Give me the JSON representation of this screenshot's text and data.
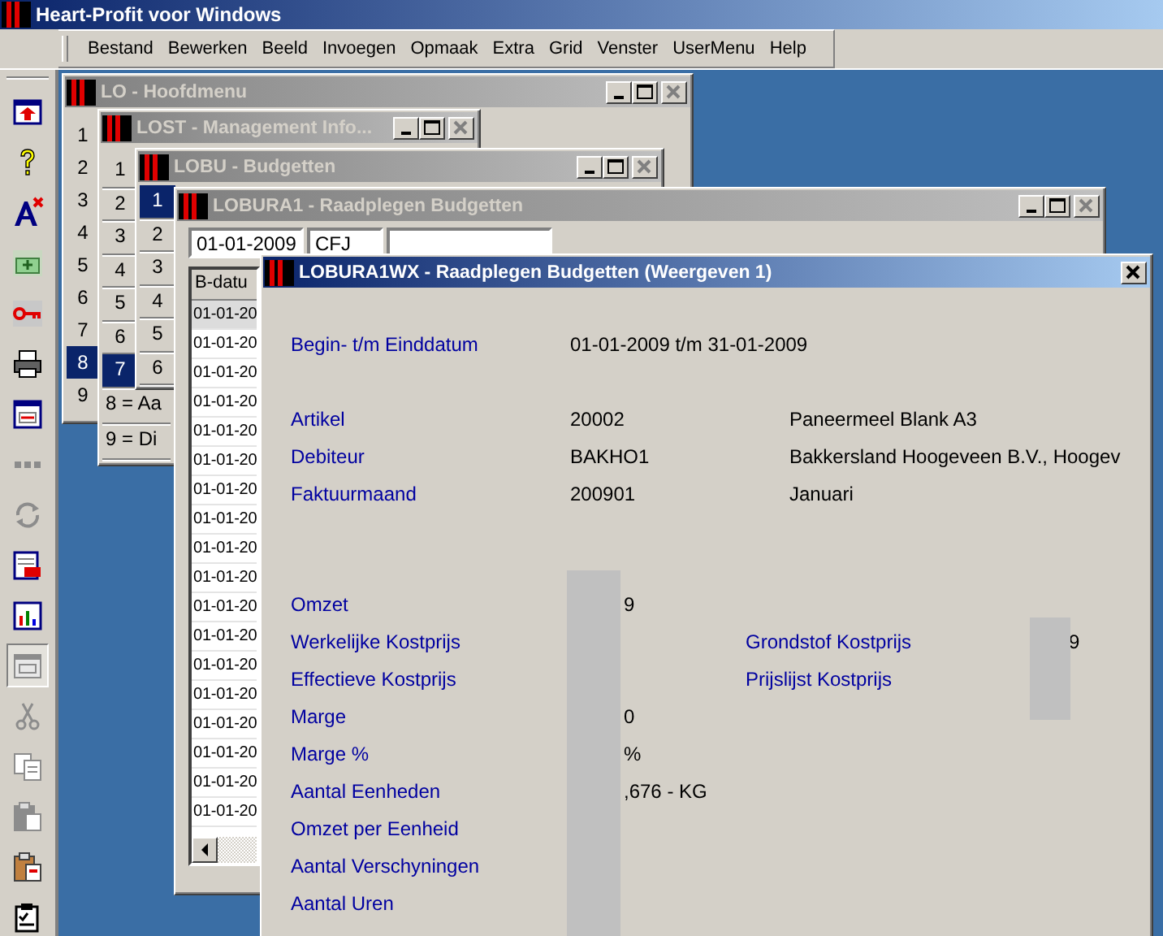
{
  "app": {
    "title": "Heart-Profit voor Windows"
  },
  "menu": [
    "Bestand",
    "Bewerken",
    "Beeld",
    "Invoegen",
    "Opmaak",
    "Extra",
    "Grid",
    "Venster",
    "UserMenu",
    "Help"
  ],
  "toolbar": [
    {
      "disabled": false
    },
    {
      "disabled": false
    },
    {
      "disabled": false
    },
    {
      "disabled": false
    },
    {
      "disabled": false
    },
    {
      "disabled": false
    },
    {
      "disabled": false
    },
    {
      "disabled": true
    },
    {
      "disabled": true
    },
    {
      "disabled": false
    },
    {
      "disabled": false
    },
    {
      "disabled": true
    },
    {
      "disabled": true
    },
    {
      "disabled": true
    },
    {
      "disabled": true
    },
    {
      "disabled": false
    },
    {
      "disabled": false
    }
  ],
  "main_menu_window": {
    "title": "LO - Hoofdmenu",
    "active": false,
    "items": [
      {
        "label": "1",
        "selected": false
      },
      {
        "label": "2",
        "selected": false
      },
      {
        "label": "3",
        "selected": false
      },
      {
        "label": "4",
        "selected": false
      },
      {
        "label": "5",
        "selected": false
      },
      {
        "label": "6",
        "selected": false
      },
      {
        "label": "7",
        "selected": false
      },
      {
        "label": "8",
        "selected": true
      },
      {
        "label": "9",
        "selected": false
      }
    ]
  },
  "management_window": {
    "title": "LOST - Management Info...",
    "active": false,
    "items": [
      {
        "label": "1",
        "selected": false
      },
      {
        "label": "2",
        "selected": false
      },
      {
        "label": "3",
        "selected": false
      },
      {
        "label": "4",
        "selected": false
      },
      {
        "label": "5",
        "selected": false
      },
      {
        "label": "6",
        "selected": false
      },
      {
        "label": "7",
        "selected": true
      },
      {
        "label": "8 = Aa",
        "selected": false
      },
      {
        "label": "9 = Di",
        "selected": false
      }
    ]
  },
  "budget_window": {
    "title": "LOBU - Budgetten",
    "active": false,
    "items": [
      {
        "label": "1",
        "selected": true
      },
      {
        "label": "2",
        "selected": false
      },
      {
        "label": "3",
        "selected": false
      },
      {
        "label": "4",
        "selected": false
      },
      {
        "label": "5",
        "selected": false
      },
      {
        "label": "6",
        "selected": false
      }
    ]
  },
  "query_window": {
    "title": "LOBURA1 - Raadplegen Budgetten",
    "active": false,
    "filters": [
      "01-01-2009",
      "CFJ"
    ],
    "grid": {
      "columns": [
        "B-datu"
      ],
      "rows": [
        {
          "cells": [
            "01-01-20"
          ],
          "selected": true
        },
        {
          "cells": [
            "01-01-20"
          ],
          "selected": false
        },
        {
          "cells": [
            "01-01-20"
          ],
          "selected": false
        },
        {
          "cells": [
            "01-01-20"
          ],
          "selected": false
        },
        {
          "cells": [
            "01-01-20"
          ],
          "selected": false
        },
        {
          "cells": [
            "01-01-20"
          ],
          "selected": false
        },
        {
          "cells": [
            "01-01-20"
          ],
          "selected": false
        },
        {
          "cells": [
            "01-01-20"
          ],
          "selected": false
        },
        {
          "cells": [
            "01-01-20"
          ],
          "selected": false
        },
        {
          "cells": [
            "01-01-20"
          ],
          "selected": false
        },
        {
          "cells": [
            "01-01-20"
          ],
          "selected": false
        },
        {
          "cells": [
            "01-01-20"
          ],
          "selected": false
        },
        {
          "cells": [
            "01-01-20"
          ],
          "selected": false
        },
        {
          "cells": [
            "01-01-20"
          ],
          "selected": false
        },
        {
          "cells": [
            "01-01-20"
          ],
          "selected": false
        },
        {
          "cells": [
            "01-01-20"
          ],
          "selected": false
        },
        {
          "cells": [
            "01-01-20"
          ],
          "selected": false
        },
        {
          "cells": [
            "01-01-20"
          ],
          "selected": false
        }
      ]
    }
  },
  "detail_window": {
    "title": "LOBURA1WX - Raadplegen Budgetten (Weergeven 1)",
    "active": true,
    "period": {
      "label": "Begin- t/m Einddatum",
      "value": "01-01-2009 t/m 31-01-2009"
    },
    "references": [
      {
        "label": "Artikel",
        "value": "20002",
        "description": "Paneermeel Blank A3"
      },
      {
        "label": "Debiteur",
        "value": "BAKHO1",
        "description": "Bakkersland Hoogeveen B.V., Hoogev"
      },
      {
        "label": "Faktuurmaand",
        "value": "200901",
        "description": "Januari"
      }
    ],
    "figures": [
      {
        "label": "Omzet",
        "value": "9"
      },
      {
        "label": "Werkelijke Kostprijs",
        "side_label": "Grondstof  Kostprijs",
        "side_value": "9"
      },
      {
        "label": "Effectieve Kostprijs",
        "side_label": "Prijslijst Kostprijs"
      },
      {
        "label": "Marge",
        "value": "0"
      },
      {
        "label": "Marge %",
        "value": "%"
      },
      {
        "label": "Aantal Eenheden",
        "value": ",676 - KG"
      },
      {
        "label": "Omzet per Eenheid"
      },
      {
        "label": "Aantal Verschyningen"
      },
      {
        "label": "Aantal Uren"
      }
    ]
  }
}
